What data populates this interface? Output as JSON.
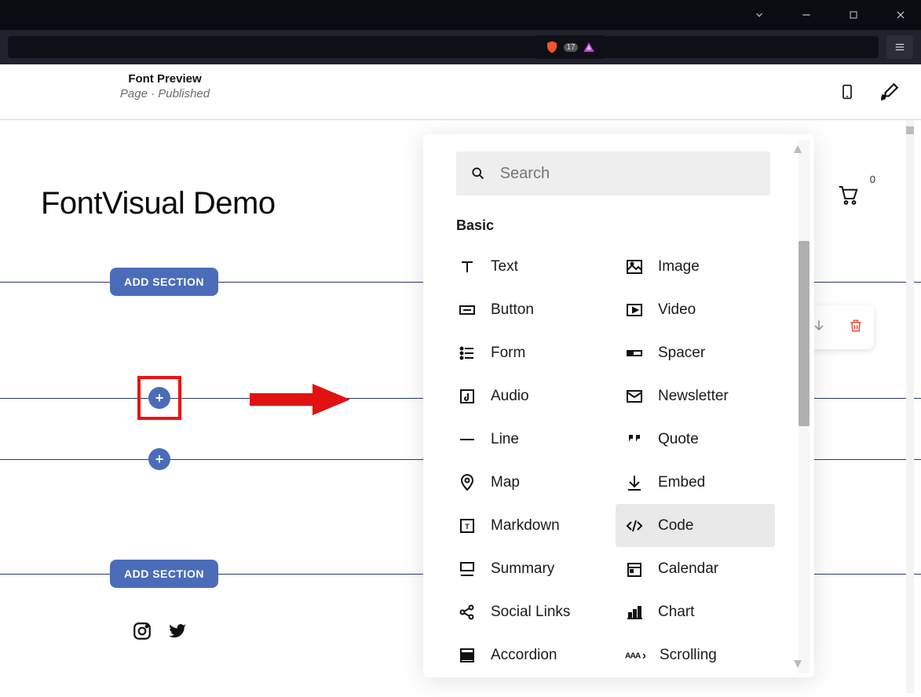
{
  "header": {
    "title": "Font Preview",
    "subtitle": "Page · Published"
  },
  "site": {
    "title": "FontVisual Demo",
    "cart_count": "0"
  },
  "buttons": {
    "add_section": "ADD SECTION"
  },
  "picker": {
    "search_placeholder": "Search",
    "section_basic": "Basic",
    "items_left": [
      "Text",
      "Button",
      "Form",
      "Audio",
      "Line",
      "Map",
      "Markdown",
      "Summary",
      "Social Links",
      "Accordion"
    ],
    "items_right": [
      "Image",
      "Video",
      "Spacer",
      "Newsletter",
      "Quote",
      "Embed",
      "Code",
      "Calendar",
      "Chart",
      "Scrolling"
    ]
  },
  "ext_badge": "17"
}
